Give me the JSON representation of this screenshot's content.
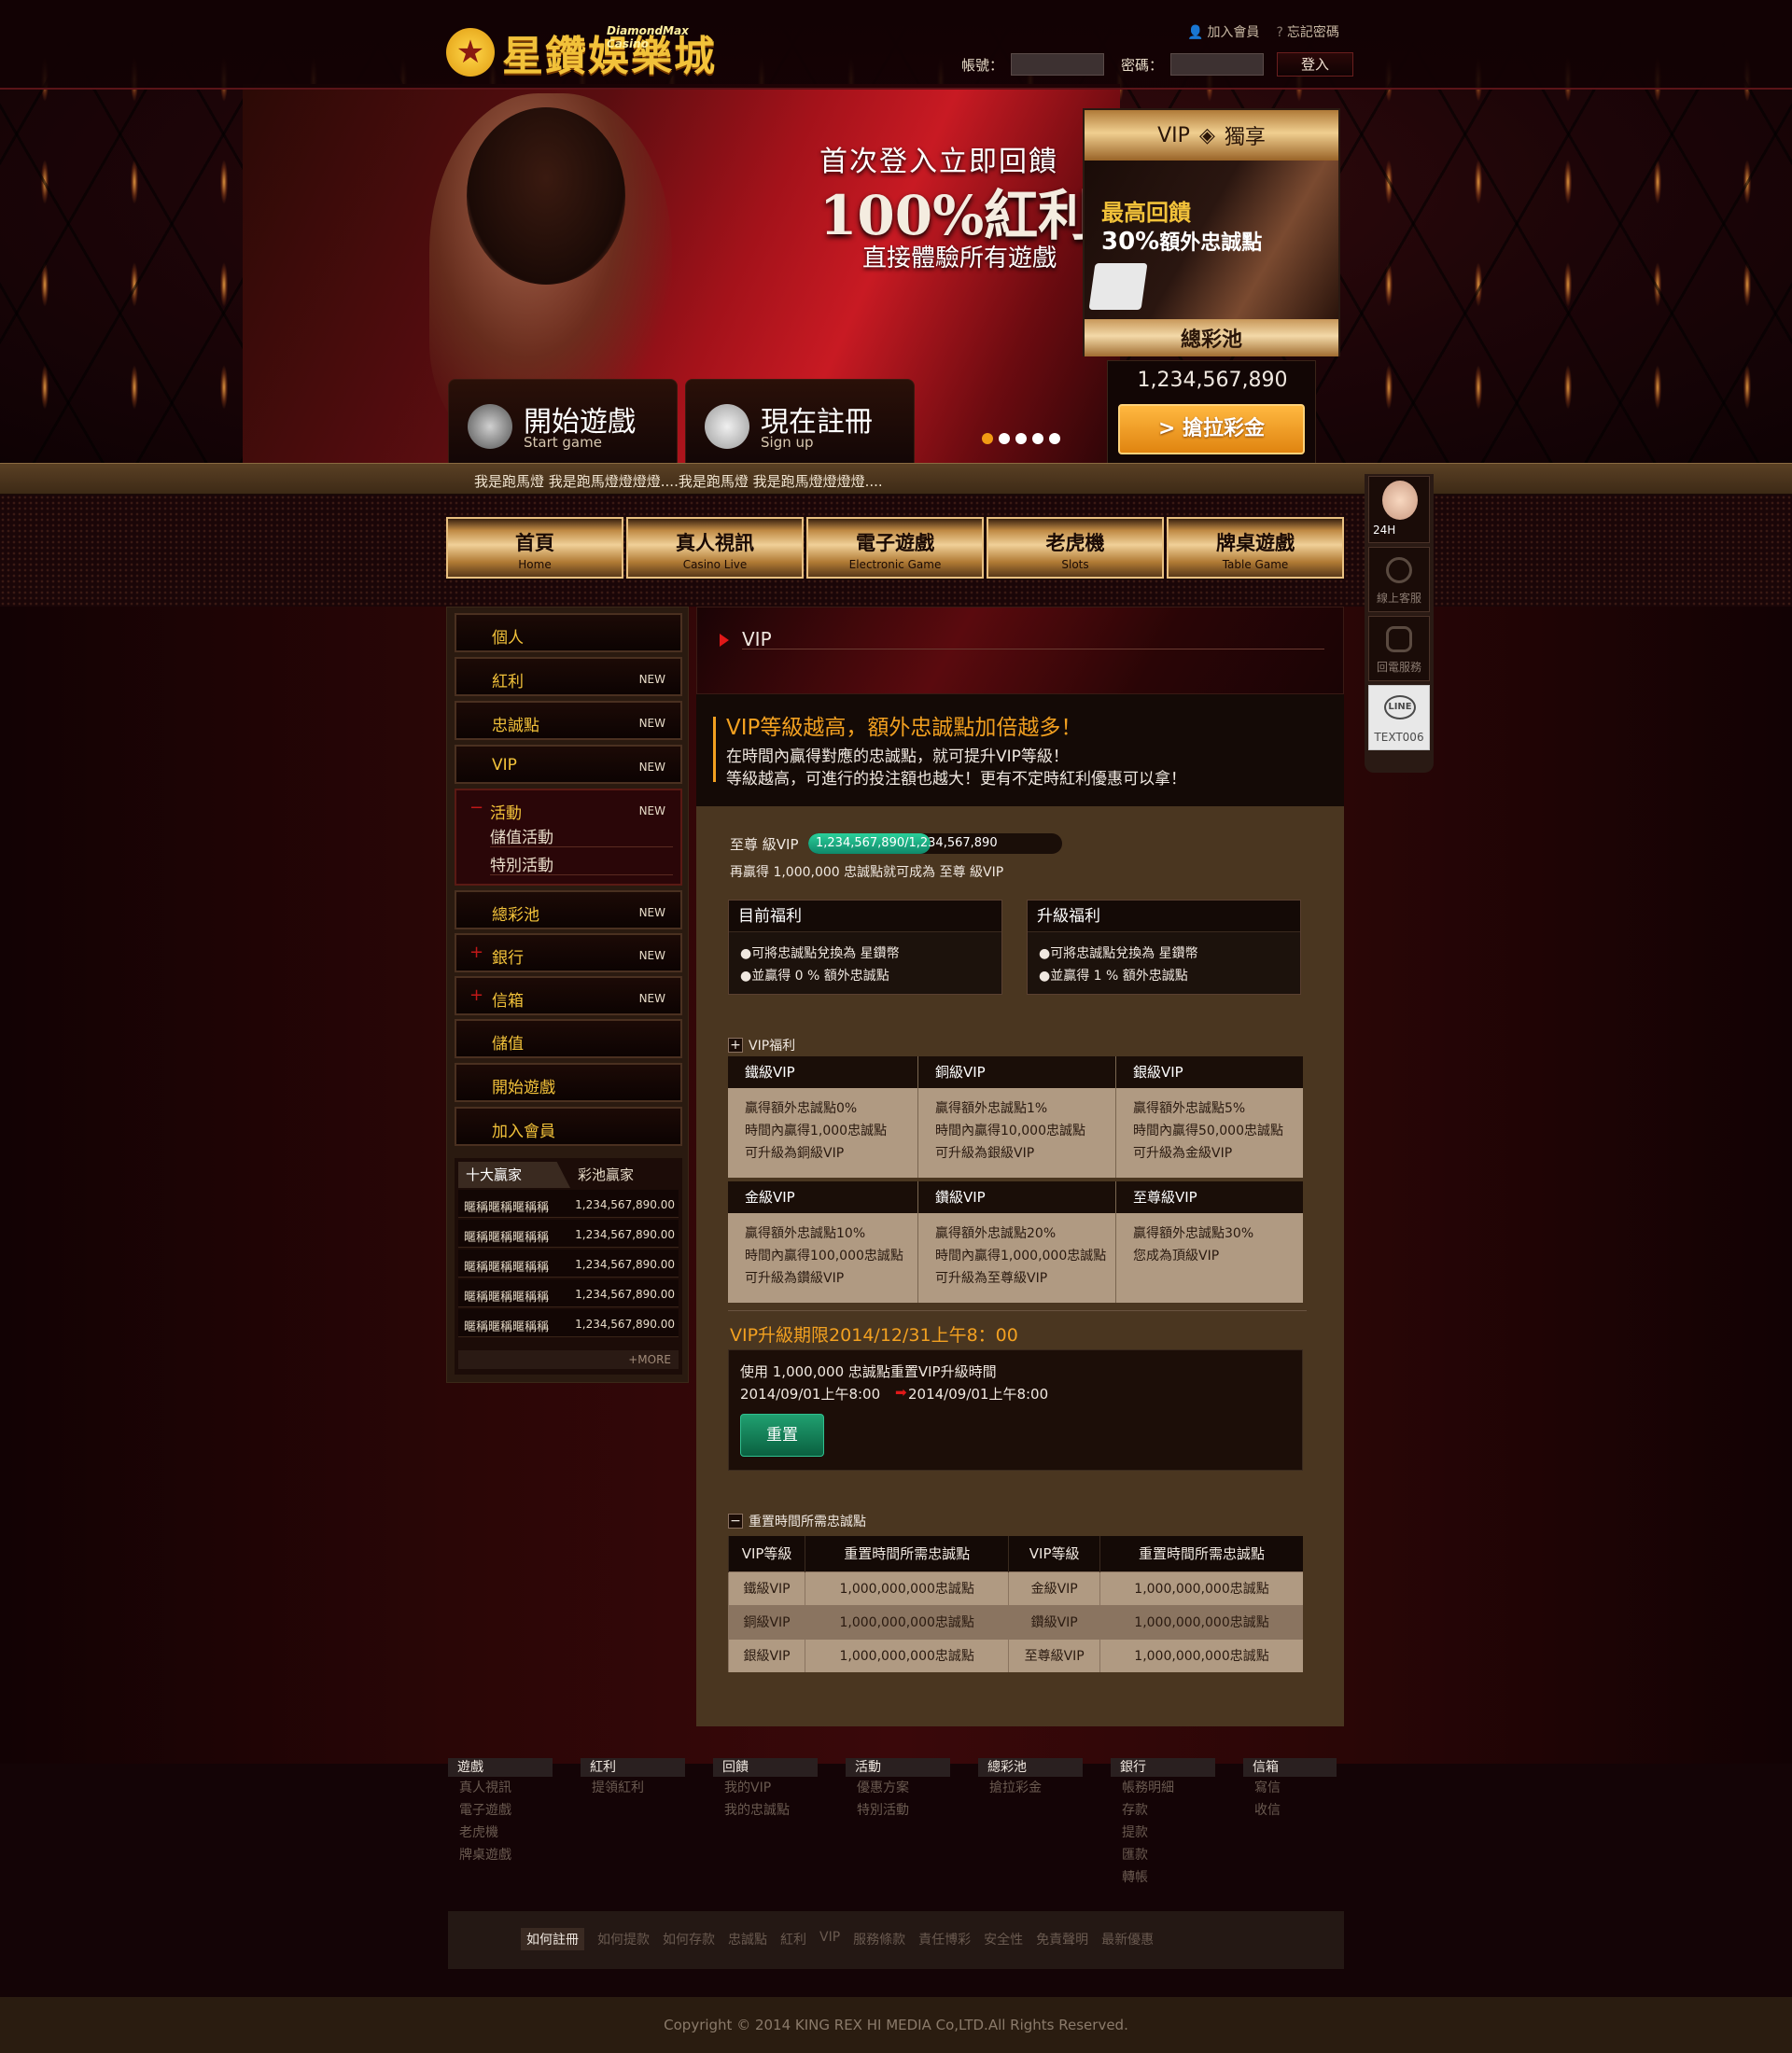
{
  "brand": {
    "logo_cn": "星鑽娛樂城",
    "logo_en": "DiamondMax Casino"
  },
  "top_links": {
    "join": "加入會員",
    "forgot": "忘記密碼"
  },
  "login": {
    "account_label": "帳號：",
    "password_label": "密碼：",
    "submit": "登入"
  },
  "hero": {
    "line1": "首次登入立即回饋",
    "line2": "100%紅利",
    "line3": "直接體驗所有遊戲",
    "start_cn": "開始遊戲",
    "start_en": "Start game",
    "signup_cn": "現在註冊",
    "signup_en": "Sign up",
    "dots": 5
  },
  "vip_panel": {
    "head_left": "VIP",
    "head_right": "獨享",
    "line1": "最高回饋",
    "line2_big": "30%",
    "line2_small": "額外忠誠點",
    "footer": "總彩池",
    "jackpot": "1,234,567,890",
    "grab": "> 搶拉彩金"
  },
  "marquee": "我是跑馬燈 我是跑馬燈燈燈燈....我是跑馬燈 我是跑馬燈燈燈燈....",
  "nav": [
    {
      "cn": "首頁",
      "en": "Home"
    },
    {
      "cn": "真人視訊",
      "en": "Casino Live"
    },
    {
      "cn": "電子遊戲",
      "en": "Electronic Game"
    },
    {
      "cn": "老虎機",
      "en": "Slots"
    },
    {
      "cn": "牌桌遊戲",
      "en": "Table Game"
    }
  ],
  "sidebar": {
    "items": [
      {
        "label": "個人",
        "new": ""
      },
      {
        "label": "紅利",
        "new": "NEW"
      },
      {
        "label": "忠誠點",
        "new": "NEW"
      },
      {
        "label": "VIP",
        "new": "NEW"
      },
      {
        "label": "活動",
        "new": "NEW",
        "sub1": "儲值活動",
        "sub2": "特別活動",
        "prefix": "−"
      },
      {
        "label": "總彩池",
        "new": "NEW"
      },
      {
        "label": "銀行",
        "new": "NEW",
        "prefix": "+"
      },
      {
        "label": "信箱",
        "new": "NEW",
        "prefix": "+"
      },
      {
        "label": "儲值",
        "new": ""
      },
      {
        "label": "開始遊戲",
        "new": ""
      },
      {
        "label": "加入會員",
        "new": ""
      }
    ],
    "winners_tab1": "十大贏家",
    "winners_tab2": "彩池贏家",
    "winners": [
      {
        "name": "暱稱暱稱暱稱稱",
        "value": "1,234,567,890.00"
      },
      {
        "name": "暱稱暱稱暱稱稱",
        "value": "1,234,567,890.00"
      },
      {
        "name": "暱稱暱稱暱稱稱",
        "value": "1,234,567,890.00"
      },
      {
        "name": "暱稱暱稱暱稱稱",
        "value": "1,234,567,890.00"
      },
      {
        "name": "暱稱暱稱暱稱稱",
        "value": "1,234,567,890.00"
      }
    ],
    "more": "+MORE"
  },
  "content": {
    "title": "VIP",
    "intro_heading": "VIP等級越高，額外忠誠點加倍越多！",
    "intro_p1": "在時間內贏得對應的忠誠點，就可提升VIP等級！",
    "intro_p2": "等級越高，可進行的投注額也越大！更有不定時紅利優惠可以拿！",
    "level_label": "至尊 級VIP",
    "progress_text": "1,234,567,890/1,234,567,890",
    "progress_fraction": 0.48,
    "level_note": "再贏得 1,000,000 忠誠點就可成為 至尊 級VIP",
    "current_title": "目前福利",
    "current_l1": "●可將忠誠點兌換為 星鑽幣",
    "current_l2": "●並贏得 0 % 額外忠誠點",
    "upgrade_title": "升級福利",
    "upgrade_l1": "●可將忠誠點兌換為 星鑽幣",
    "upgrade_l2": "●並贏得 1 % 額外忠誠點",
    "vip_benefits_title": "VIP福利",
    "vip_tiers": [
      {
        "name": "鐵級VIP",
        "l1": "贏得額外忠誠點0%",
        "l2": "時間內贏得1,000忠誠點",
        "l3": "可升級為銅級VIP"
      },
      {
        "name": "銅級VIP",
        "l1": "贏得額外忠誠點1%",
        "l2": "時間內贏得10,000忠誠點",
        "l3": "可升級為銀級VIP"
      },
      {
        "name": "銀級VIP",
        "l1": "贏得額外忠誠點5%",
        "l2": "時間內贏得50,000忠誠點",
        "l3": "可升級為金級VIP"
      },
      {
        "name": "金級VIP",
        "l1": "贏得額外忠誠點10%",
        "l2": "時間內贏得100,000忠誠點",
        "l3": "可升級為鑽級VIP"
      },
      {
        "name": "鑽級VIP",
        "l1": "贏得額外忠誠點20%",
        "l2": "時間內贏得1,000,000忠誠點",
        "l3": "可升級為至尊級VIP"
      },
      {
        "name": "至尊級VIP",
        "l1": "贏得額外忠誠點30%",
        "l2": "您成為頂級VIP",
        "l3": ""
      }
    ],
    "deadline": "VIP升級期限2014/12/31上午8：00",
    "reset_l1": "使用 1,000,000 忠誠點重置VIP升級時間",
    "reset_from": "2014/09/01上午8:00",
    "reset_arrow": "➡",
    "reset_to": "2014/09/01上午8:00",
    "reset_btn": "重置",
    "reset_table_title": "重置時間所需忠誠點",
    "table_headers": [
      "VIP等級",
      "重置時間所需忠誠點",
      "VIP等級",
      "重置時間所需忠誠點"
    ],
    "table_rows": [
      [
        "鐵級VIP",
        "1,000,000,000忠誠點",
        "金級VIP",
        "1,000,000,000忠誠點"
      ],
      [
        "銅級VIP",
        "1,000,000,000忠誠點",
        "鑽級VIP",
        "1,000,000,000忠誠點"
      ],
      [
        "銀級VIP",
        "1,000,000,000忠誠點",
        "至尊級VIP",
        "1,000,000,000忠誠點"
      ]
    ]
  },
  "support": {
    "badge": "24H",
    "online": "線上客服",
    "callback": "回電服務",
    "line_label": "LINE",
    "line_id": "TEXT006"
  },
  "footer_cols": [
    {
      "h": "遊戲",
      "items": [
        "真人視訊",
        "電子遊戲",
        "老虎機",
        "牌桌遊戲"
      ]
    },
    {
      "h": "紅利",
      "items": [
        "提領紅利"
      ]
    },
    {
      "h": "回饋",
      "items": [
        "我的VIP",
        "我的忠誠點"
      ]
    },
    {
      "h": "活動",
      "items": [
        "優惠方案",
        "特別活動"
      ]
    },
    {
      "h": "總彩池",
      "items": [
        "搶拉彩金"
      ]
    },
    {
      "h": "銀行",
      "items": [
        "帳務明細",
        "存款",
        "提款",
        "匯款",
        "轉帳"
      ]
    },
    {
      "h": "信箱",
      "items": [
        "寫信",
        "收信"
      ]
    }
  ],
  "footer_bar": [
    "如何註冊",
    "如何提款",
    "如何存款",
    "忠誠點",
    "紅利",
    "VIP",
    "服務條款",
    "責任博彩",
    "安全性",
    "免責聲明",
    "最新優惠"
  ],
  "copyright": "Copyright © 2014 KING REX HI MEDIA Co,LTD.All Rights Reserved.",
  "colors": {
    "gold": "#f2c23a",
    "accent_orange": "#f2a020",
    "progress_green": "#2ad09a",
    "brand_red": "#c81a23"
  }
}
